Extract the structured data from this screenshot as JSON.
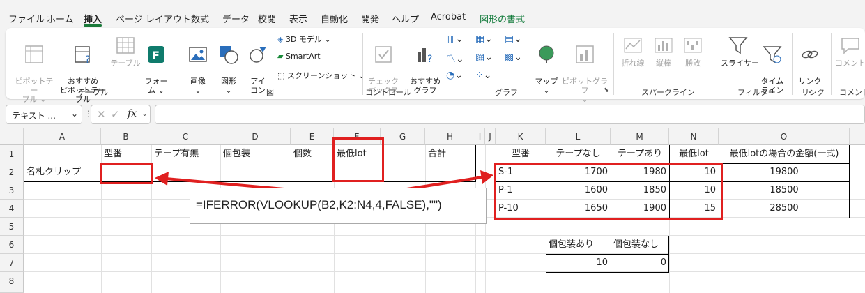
{
  "menu": [
    "ファイル",
    "ホーム",
    "挿入",
    "ページ レイアウト",
    "数式",
    "データ",
    "校閲",
    "表示",
    "自動化",
    "開発",
    "ヘルプ",
    "Acrobat",
    "図形の書式"
  ],
  "ribbon": {
    "pivot": "ピボットテー\nブル ⌄",
    "recommended_pivot": "おすすめ\nピボットテーブル",
    "table": "テーブル",
    "forms": "フォー\nム ⌄",
    "group_table": "テーブル",
    "image": "画像\n⌄",
    "shapes": "図形\n⌄",
    "icons": "アイ\nコン",
    "model3d": "3D モデル",
    "smartart": "SmartArt",
    "screenshot": "スクリーンショット ⌄",
    "group_illust": "図",
    "checkbox": "チェック\nボックス",
    "group_control": "コントロール",
    "rec_chart": "おすすめ\nグラフ",
    "map": "マップ\n⌄",
    "pivot_chart": "ピボットグラフ\n⌄",
    "group_chart": "グラフ",
    "line": "折れ線",
    "column": "縦棒",
    "winloss": "勝敗",
    "group_spark": "スパークライン",
    "slicer": "スライサー",
    "timeline": "タイム\nライン",
    "group_filter": "フィルター",
    "link": "リンク\n⌄",
    "group_link": "リンク",
    "comment": "コメント",
    "group_comment": "コメント"
  },
  "formula_bar": {
    "name_box": "テキスト ...",
    "fx": "fx",
    "value": ""
  },
  "columns": [
    "A",
    "B",
    "C",
    "D",
    "E",
    "F",
    "G",
    "H",
    "I",
    "J",
    "K",
    "L",
    "M",
    "N",
    "O"
  ],
  "rows": [
    "1",
    "2",
    "3",
    "4",
    "5",
    "6",
    "7",
    "8"
  ],
  "left_table": {
    "headers": [
      "型番",
      "テープ有無",
      "個包装",
      "個数",
      "最低lot",
      "合計"
    ],
    "row2_label": "名札クリップ"
  },
  "price_table": {
    "headers": [
      "型番",
      "テープなし",
      "テープあり",
      "最低lot",
      "最低lotの場合の金額(一式)"
    ],
    "rows": [
      [
        "S-1",
        "1700",
        "1980",
        "10",
        "19800"
      ],
      [
        "P-1",
        "1600",
        "1850",
        "10",
        "18500"
      ],
      [
        "P-10",
        "1650",
        "1900",
        "15",
        "28500"
      ]
    ]
  },
  "packaging_table": {
    "headers": [
      "個包装あり",
      "個包装なし"
    ],
    "values": [
      "10",
      "0"
    ]
  },
  "callout_formula": "=IFERROR(VLOOKUP(B2,K2:N4,4,FALSE),\"\")",
  "colors": {
    "accent_green": "#117a3a",
    "annotation_red": "#e02020"
  }
}
